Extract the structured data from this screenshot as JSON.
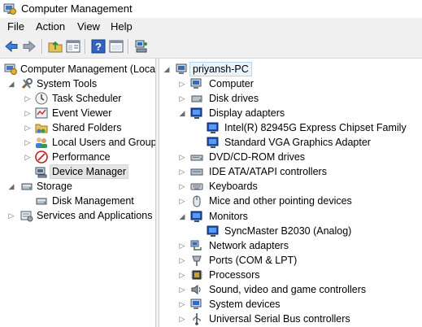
{
  "window": {
    "title": "Computer Management",
    "icon": "computer-management-icon"
  },
  "menu": {
    "file": "File",
    "action": "Action",
    "view": "View",
    "help": "Help"
  },
  "toolbar": {
    "buttons": [
      "back-arrow-icon",
      "forward-arrow-icon",
      "up-folder-icon",
      "show-hide-console-tree-icon",
      "help-icon",
      "properties-icon",
      "scan-hardware-icon"
    ]
  },
  "left_tree": {
    "root": "Computer Management (Local",
    "system_tools": "System Tools",
    "task_scheduler": "Task Scheduler",
    "event_viewer": "Event Viewer",
    "shared_folders": "Shared Folders",
    "local_users": "Local Users and Groups",
    "performance": "Performance",
    "device_manager": "Device Manager",
    "storage": "Storage",
    "disk_management": "Disk Management",
    "services": "Services and Applications"
  },
  "right_tree": {
    "root": "priyansh-PC",
    "computer": "Computer",
    "disk_drives": "Disk drives",
    "display_adapters": "Display adapters",
    "display_1": "Intel(R) 82945G Express Chipset Family",
    "display_2": "Standard VGA Graphics Adapter",
    "dvd": "DVD/CD-ROM drives",
    "ide": "IDE ATA/ATAPI controllers",
    "keyboards": "Keyboards",
    "mice": "Mice and other pointing devices",
    "monitors": "Monitors",
    "monitor_1": "SyncMaster B2030 (Analog)",
    "network": "Network adapters",
    "ports": "Ports (COM & LPT)",
    "processors": "Processors",
    "sound": "Sound, video and game controllers",
    "system_devices": "System devices",
    "usb": "Universal Serial Bus controllers"
  },
  "colors": {
    "menu_bg": "#f0f0f0",
    "selection_bg": "#e5e5e5",
    "root_highlight": "#e9f3fb",
    "monitor_blue": "#1e4fb8"
  }
}
